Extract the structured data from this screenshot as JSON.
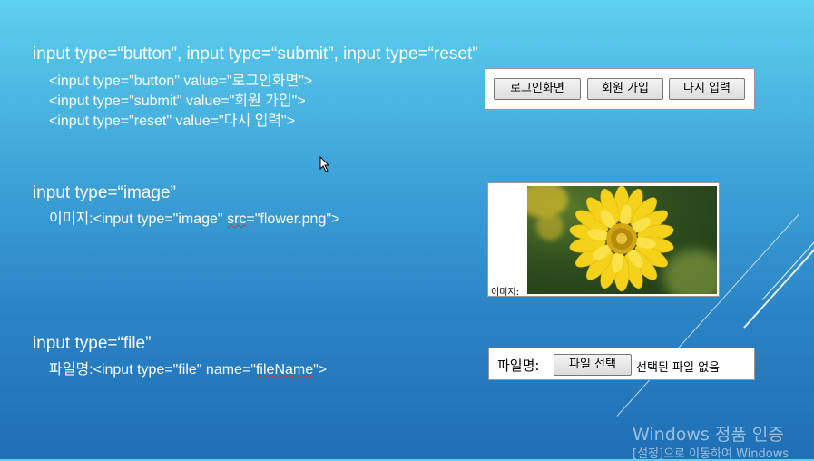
{
  "section_button": {
    "heading": "input type=“button”,  input type=“submit”, input type=“reset”",
    "code_lines": [
      "<input type=\"button\" value=\"로그인화면\">",
      "<input type=\"submit\" value=\"회원 가입\">",
      "<input type=\"reset\" value=\"다시 입력\">"
    ],
    "demo_buttons": [
      "로그인화면",
      "회원 가입",
      "다시 입력"
    ]
  },
  "section_image": {
    "heading": "input type=“image”",
    "code_prefix": "이미지:<input type=\"image\" ",
    "code_attr": "src",
    "code_suffix": "=\"flower.png\">",
    "demo_label": "이미지:",
    "image_alt": "flower"
  },
  "section_file": {
    "heading": "input type=“file”",
    "code_prefix": "파일명:<input type=\"file\" name=\"",
    "code_attr": "fileName",
    "code_suffix": "\">",
    "demo_label": "파일명:",
    "demo_button": "파일 선택",
    "demo_status": "선택된 파일 없음"
  },
  "watermark": {
    "line1": "Windows 정품 인증",
    "line2": "[설정]으로 이동하여 Windows"
  },
  "colors": {
    "accent": "#ffffff",
    "background_top": "#5ed0ee",
    "background_bottom": "#1f6fb5"
  }
}
